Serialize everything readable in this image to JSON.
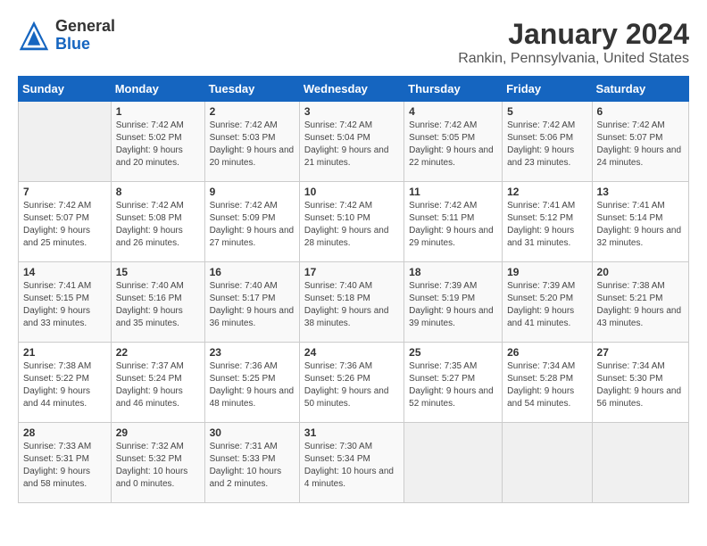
{
  "header": {
    "logo_general": "General",
    "logo_blue": "Blue",
    "title": "January 2024",
    "subtitle": "Rankin, Pennsylvania, United States"
  },
  "days_of_week": [
    "Sunday",
    "Monday",
    "Tuesday",
    "Wednesday",
    "Thursday",
    "Friday",
    "Saturday"
  ],
  "weeks": [
    [
      {
        "day": "",
        "sunrise": "",
        "sunset": "",
        "daylight": "",
        "empty": true
      },
      {
        "day": "1",
        "sunrise": "Sunrise: 7:42 AM",
        "sunset": "Sunset: 5:02 PM",
        "daylight": "Daylight: 9 hours and 20 minutes."
      },
      {
        "day": "2",
        "sunrise": "Sunrise: 7:42 AM",
        "sunset": "Sunset: 5:03 PM",
        "daylight": "Daylight: 9 hours and 20 minutes."
      },
      {
        "day": "3",
        "sunrise": "Sunrise: 7:42 AM",
        "sunset": "Sunset: 5:04 PM",
        "daylight": "Daylight: 9 hours and 21 minutes."
      },
      {
        "day": "4",
        "sunrise": "Sunrise: 7:42 AM",
        "sunset": "Sunset: 5:05 PM",
        "daylight": "Daylight: 9 hours and 22 minutes."
      },
      {
        "day": "5",
        "sunrise": "Sunrise: 7:42 AM",
        "sunset": "Sunset: 5:06 PM",
        "daylight": "Daylight: 9 hours and 23 minutes."
      },
      {
        "day": "6",
        "sunrise": "Sunrise: 7:42 AM",
        "sunset": "Sunset: 5:07 PM",
        "daylight": "Daylight: 9 hours and 24 minutes."
      }
    ],
    [
      {
        "day": "7",
        "sunrise": "Sunrise: 7:42 AM",
        "sunset": "Sunset: 5:07 PM",
        "daylight": "Daylight: 9 hours and 25 minutes."
      },
      {
        "day": "8",
        "sunrise": "Sunrise: 7:42 AM",
        "sunset": "Sunset: 5:08 PM",
        "daylight": "Daylight: 9 hours and 26 minutes."
      },
      {
        "day": "9",
        "sunrise": "Sunrise: 7:42 AM",
        "sunset": "Sunset: 5:09 PM",
        "daylight": "Daylight: 9 hours and 27 minutes."
      },
      {
        "day": "10",
        "sunrise": "Sunrise: 7:42 AM",
        "sunset": "Sunset: 5:10 PM",
        "daylight": "Daylight: 9 hours and 28 minutes."
      },
      {
        "day": "11",
        "sunrise": "Sunrise: 7:42 AM",
        "sunset": "Sunset: 5:11 PM",
        "daylight": "Daylight: 9 hours and 29 minutes."
      },
      {
        "day": "12",
        "sunrise": "Sunrise: 7:41 AM",
        "sunset": "Sunset: 5:12 PM",
        "daylight": "Daylight: 9 hours and 31 minutes."
      },
      {
        "day": "13",
        "sunrise": "Sunrise: 7:41 AM",
        "sunset": "Sunset: 5:14 PM",
        "daylight": "Daylight: 9 hours and 32 minutes."
      }
    ],
    [
      {
        "day": "14",
        "sunrise": "Sunrise: 7:41 AM",
        "sunset": "Sunset: 5:15 PM",
        "daylight": "Daylight: 9 hours and 33 minutes."
      },
      {
        "day": "15",
        "sunrise": "Sunrise: 7:40 AM",
        "sunset": "Sunset: 5:16 PM",
        "daylight": "Daylight: 9 hours and 35 minutes."
      },
      {
        "day": "16",
        "sunrise": "Sunrise: 7:40 AM",
        "sunset": "Sunset: 5:17 PM",
        "daylight": "Daylight: 9 hours and 36 minutes."
      },
      {
        "day": "17",
        "sunrise": "Sunrise: 7:40 AM",
        "sunset": "Sunset: 5:18 PM",
        "daylight": "Daylight: 9 hours and 38 minutes."
      },
      {
        "day": "18",
        "sunrise": "Sunrise: 7:39 AM",
        "sunset": "Sunset: 5:19 PM",
        "daylight": "Daylight: 9 hours and 39 minutes."
      },
      {
        "day": "19",
        "sunrise": "Sunrise: 7:39 AM",
        "sunset": "Sunset: 5:20 PM",
        "daylight": "Daylight: 9 hours and 41 minutes."
      },
      {
        "day": "20",
        "sunrise": "Sunrise: 7:38 AM",
        "sunset": "Sunset: 5:21 PM",
        "daylight": "Daylight: 9 hours and 43 minutes."
      }
    ],
    [
      {
        "day": "21",
        "sunrise": "Sunrise: 7:38 AM",
        "sunset": "Sunset: 5:22 PM",
        "daylight": "Daylight: 9 hours and 44 minutes."
      },
      {
        "day": "22",
        "sunrise": "Sunrise: 7:37 AM",
        "sunset": "Sunset: 5:24 PM",
        "daylight": "Daylight: 9 hours and 46 minutes."
      },
      {
        "day": "23",
        "sunrise": "Sunrise: 7:36 AM",
        "sunset": "Sunset: 5:25 PM",
        "daylight": "Daylight: 9 hours and 48 minutes."
      },
      {
        "day": "24",
        "sunrise": "Sunrise: 7:36 AM",
        "sunset": "Sunset: 5:26 PM",
        "daylight": "Daylight: 9 hours and 50 minutes."
      },
      {
        "day": "25",
        "sunrise": "Sunrise: 7:35 AM",
        "sunset": "Sunset: 5:27 PM",
        "daylight": "Daylight: 9 hours and 52 minutes."
      },
      {
        "day": "26",
        "sunrise": "Sunrise: 7:34 AM",
        "sunset": "Sunset: 5:28 PM",
        "daylight": "Daylight: 9 hours and 54 minutes."
      },
      {
        "day": "27",
        "sunrise": "Sunrise: 7:34 AM",
        "sunset": "Sunset: 5:30 PM",
        "daylight": "Daylight: 9 hours and 56 minutes."
      }
    ],
    [
      {
        "day": "28",
        "sunrise": "Sunrise: 7:33 AM",
        "sunset": "Sunset: 5:31 PM",
        "daylight": "Daylight: 9 hours and 58 minutes."
      },
      {
        "day": "29",
        "sunrise": "Sunrise: 7:32 AM",
        "sunset": "Sunset: 5:32 PM",
        "daylight": "Daylight: 10 hours and 0 minutes."
      },
      {
        "day": "30",
        "sunrise": "Sunrise: 7:31 AM",
        "sunset": "Sunset: 5:33 PM",
        "daylight": "Daylight: 10 hours and 2 minutes."
      },
      {
        "day": "31",
        "sunrise": "Sunrise: 7:30 AM",
        "sunset": "Sunset: 5:34 PM",
        "daylight": "Daylight: 10 hours and 4 minutes."
      },
      {
        "day": "",
        "sunrise": "",
        "sunset": "",
        "daylight": "",
        "empty": true
      },
      {
        "day": "",
        "sunrise": "",
        "sunset": "",
        "daylight": "",
        "empty": true
      },
      {
        "day": "",
        "sunrise": "",
        "sunset": "",
        "daylight": "",
        "empty": true
      }
    ]
  ]
}
